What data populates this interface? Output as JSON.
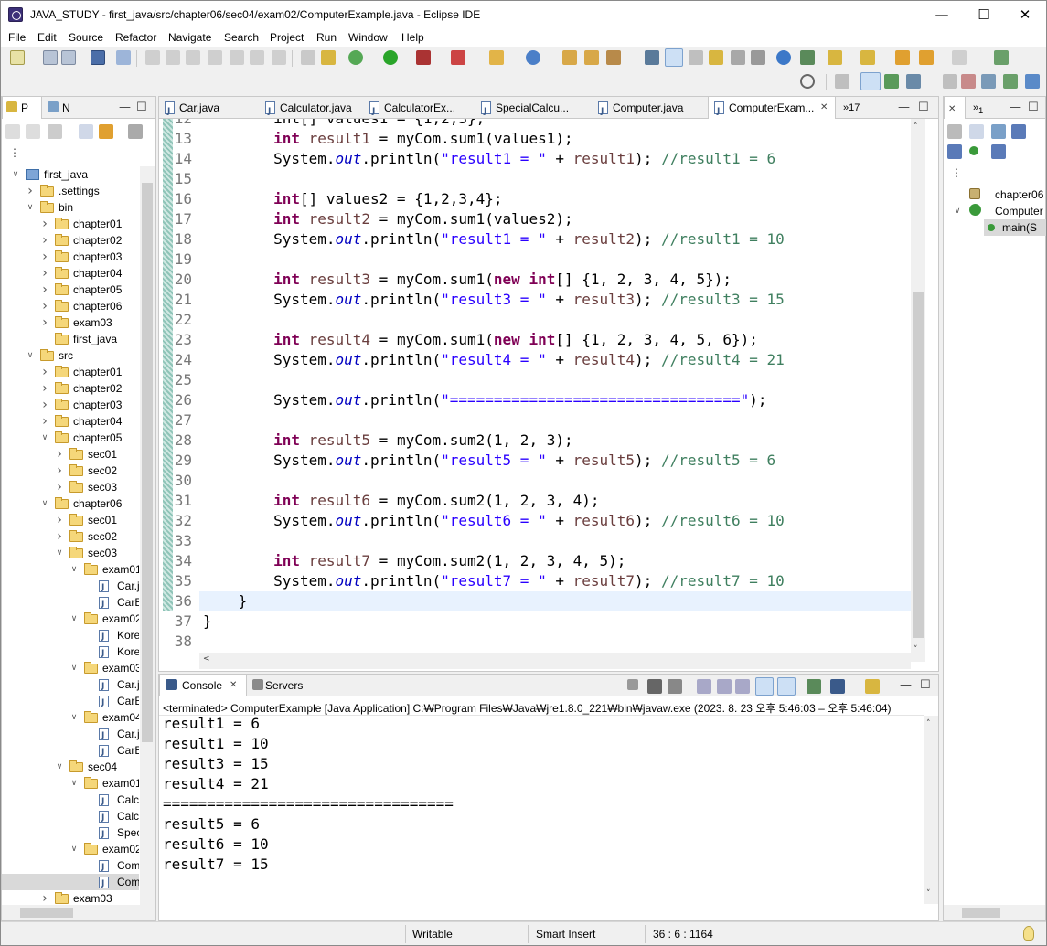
{
  "window": {
    "title": "JAVA_STUDY - first_java/src/chapter06/sec04/exam02/ComputerExample.java - Eclipse IDE",
    "minimize": "—",
    "maximize": "☐",
    "close": "✕"
  },
  "menu": [
    "File",
    "Edit",
    "Source",
    "Refactor",
    "Navigate",
    "Search",
    "Project",
    "Run",
    "Window",
    "Help"
  ],
  "left_panel": {
    "tabs": [
      "P",
      "N"
    ],
    "tree": [
      {
        "label": "first_java",
        "depth": 0,
        "open": true,
        "kind": "project"
      },
      {
        "label": ".settings",
        "depth": 1,
        "open": false,
        "kind": "folder"
      },
      {
        "label": "bin",
        "depth": 1,
        "open": true,
        "kind": "folder"
      },
      {
        "label": "chapter01",
        "depth": 2,
        "open": false,
        "kind": "folder"
      },
      {
        "label": "chapter02",
        "depth": 2,
        "open": false,
        "kind": "folder"
      },
      {
        "label": "chapter03",
        "depth": 2,
        "open": false,
        "kind": "folder"
      },
      {
        "label": "chapter04",
        "depth": 2,
        "open": false,
        "kind": "folder"
      },
      {
        "label": "chapter05",
        "depth": 2,
        "open": false,
        "kind": "folder"
      },
      {
        "label": "chapter06",
        "depth": 2,
        "open": false,
        "kind": "folder"
      },
      {
        "label": "exam03",
        "depth": 2,
        "open": false,
        "kind": "folder"
      },
      {
        "label": "first_java",
        "depth": 2,
        "open": null,
        "kind": "folder"
      },
      {
        "label": "src",
        "depth": 1,
        "open": true,
        "kind": "folder"
      },
      {
        "label": "chapter01",
        "depth": 2,
        "open": false,
        "kind": "folder"
      },
      {
        "label": "chapter02",
        "depth": 2,
        "open": false,
        "kind": "folder"
      },
      {
        "label": "chapter03",
        "depth": 2,
        "open": false,
        "kind": "folder"
      },
      {
        "label": "chapter04",
        "depth": 2,
        "open": false,
        "kind": "folder"
      },
      {
        "label": "chapter05",
        "depth": 2,
        "open": true,
        "kind": "folder"
      },
      {
        "label": "sec01",
        "depth": 3,
        "open": false,
        "kind": "folder"
      },
      {
        "label": "sec02",
        "depth": 3,
        "open": false,
        "kind": "folder"
      },
      {
        "label": "sec03",
        "depth": 3,
        "open": false,
        "kind": "folder"
      },
      {
        "label": "chapter06",
        "depth": 2,
        "open": true,
        "kind": "folder"
      },
      {
        "label": "sec01",
        "depth": 3,
        "open": false,
        "kind": "folder"
      },
      {
        "label": "sec02",
        "depth": 3,
        "open": false,
        "kind": "folder"
      },
      {
        "label": "sec03",
        "depth": 3,
        "open": true,
        "kind": "folder"
      },
      {
        "label": "exam01",
        "depth": 4,
        "open": true,
        "kind": "folder"
      },
      {
        "label": "Car.j",
        "depth": 5,
        "open": null,
        "kind": "java"
      },
      {
        "label": "CarE",
        "depth": 5,
        "open": null,
        "kind": "java"
      },
      {
        "label": "exam02",
        "depth": 4,
        "open": true,
        "kind": "folder"
      },
      {
        "label": "Kore",
        "depth": 5,
        "open": null,
        "kind": "java"
      },
      {
        "label": "Kore",
        "depth": 5,
        "open": null,
        "kind": "java"
      },
      {
        "label": "exam03",
        "depth": 4,
        "open": true,
        "kind": "folder"
      },
      {
        "label": "Car.j",
        "depth": 5,
        "open": null,
        "kind": "java"
      },
      {
        "label": "CarE",
        "depth": 5,
        "open": null,
        "kind": "java"
      },
      {
        "label": "exam04",
        "depth": 4,
        "open": true,
        "kind": "folder"
      },
      {
        "label": "Car.j",
        "depth": 5,
        "open": null,
        "kind": "java"
      },
      {
        "label": "CarE",
        "depth": 5,
        "open": null,
        "kind": "java"
      },
      {
        "label": "sec04",
        "depth": 3,
        "open": true,
        "kind": "folder"
      },
      {
        "label": "exam01",
        "depth": 4,
        "open": true,
        "kind": "folder"
      },
      {
        "label": "Calcu",
        "depth": 5,
        "open": null,
        "kind": "java"
      },
      {
        "label": "Calcu",
        "depth": 5,
        "open": null,
        "kind": "java"
      },
      {
        "label": "Spec",
        "depth": 5,
        "open": null,
        "kind": "java"
      },
      {
        "label": "exam02",
        "depth": 4,
        "open": true,
        "kind": "folder"
      },
      {
        "label": "Com",
        "depth": 5,
        "open": null,
        "kind": "java"
      },
      {
        "label": "Com",
        "depth": 5,
        "open": null,
        "kind": "java",
        "selected": true
      },
      {
        "label": "exam03",
        "depth": 2,
        "open": false,
        "kind": "folder"
      }
    ]
  },
  "editor": {
    "tabs": [
      {
        "label": "Car.java",
        "active": false
      },
      {
        "label": "Calculator.java",
        "active": false
      },
      {
        "label": "CalculatorEx...",
        "active": false
      },
      {
        "label": "SpecialCalcu...",
        "active": false
      },
      {
        "label": "Computer.java",
        "active": false
      },
      {
        "label": "ComputerExam...",
        "active": true
      }
    ],
    "overflow": "»17",
    "partial_line": "        int[] values1 = {1,2,3};",
    "lines": [
      {
        "n": "12",
        "code": []
      },
      {
        "n": "13",
        "code": [
          [
            "",
            "        "
          ],
          [
            "kw",
            "int"
          ],
          [
            "",
            " "
          ],
          [
            "var",
            "result1"
          ],
          [
            "",
            " = myCom.sum1(values1);"
          ]
        ]
      },
      {
        "n": "14",
        "code": [
          [
            "",
            "        System."
          ],
          [
            "fld",
            "out"
          ],
          [
            "",
            ".println("
          ],
          [
            "str",
            "\"result1 = \""
          ],
          [
            "",
            " + "
          ],
          [
            "var",
            "result1"
          ],
          [
            "",
            "); "
          ],
          [
            "cm",
            "//result1 = 6"
          ]
        ]
      },
      {
        "n": "15",
        "code": []
      },
      {
        "n": "16",
        "code": [
          [
            "",
            "        "
          ],
          [
            "kw",
            "int"
          ],
          [
            "",
            "[] values2 = {1,2,3,4};"
          ]
        ]
      },
      {
        "n": "17",
        "code": [
          [
            "",
            "        "
          ],
          [
            "kw",
            "int"
          ],
          [
            "",
            " "
          ],
          [
            "var",
            "result2"
          ],
          [
            "",
            " = myCom.sum1(values2);"
          ]
        ]
      },
      {
        "n": "18",
        "code": [
          [
            "",
            "        System."
          ],
          [
            "fld",
            "out"
          ],
          [
            "",
            ".println("
          ],
          [
            "str",
            "\"result1 = \""
          ],
          [
            "",
            " + "
          ],
          [
            "var",
            "result2"
          ],
          [
            "",
            "); "
          ],
          [
            "cm",
            "//result1 = 10"
          ]
        ]
      },
      {
        "n": "19",
        "code": []
      },
      {
        "n": "20",
        "code": [
          [
            "",
            "        "
          ],
          [
            "kw",
            "int"
          ],
          [
            "",
            " "
          ],
          [
            "var",
            "result3"
          ],
          [
            "",
            " = myCom.sum1("
          ],
          [
            "kw",
            "new"
          ],
          [
            "",
            " "
          ],
          [
            "kw",
            "int"
          ],
          [
            "",
            "[] {1, 2, 3, 4, 5});"
          ]
        ]
      },
      {
        "n": "21",
        "code": [
          [
            "",
            "        System."
          ],
          [
            "fld",
            "out"
          ],
          [
            "",
            ".println("
          ],
          [
            "str",
            "\"result3 = \""
          ],
          [
            "",
            " + "
          ],
          [
            "var",
            "result3"
          ],
          [
            "",
            "); "
          ],
          [
            "cm",
            "//result3 = 15"
          ]
        ]
      },
      {
        "n": "22",
        "code": []
      },
      {
        "n": "23",
        "code": [
          [
            "",
            "        "
          ],
          [
            "kw",
            "int"
          ],
          [
            "",
            " "
          ],
          [
            "var",
            "result4"
          ],
          [
            "",
            " = myCom.sum1("
          ],
          [
            "kw",
            "new"
          ],
          [
            "",
            " "
          ],
          [
            "kw",
            "int"
          ],
          [
            "",
            "[] {1, 2, 3, 4, 5, 6});"
          ]
        ]
      },
      {
        "n": "24",
        "code": [
          [
            "",
            "        System."
          ],
          [
            "fld",
            "out"
          ],
          [
            "",
            ".println("
          ],
          [
            "str",
            "\"result4 = \""
          ],
          [
            "",
            " + "
          ],
          [
            "var",
            "result4"
          ],
          [
            "",
            "); "
          ],
          [
            "cm",
            "//result4 = 21"
          ]
        ]
      },
      {
        "n": "25",
        "code": []
      },
      {
        "n": "26",
        "code": [
          [
            "",
            "        System."
          ],
          [
            "fld",
            "out"
          ],
          [
            "",
            ".println("
          ],
          [
            "str",
            "\"=================================\""
          ],
          [
            "",
            ");"
          ]
        ]
      },
      {
        "n": "27",
        "code": []
      },
      {
        "n": "28",
        "code": [
          [
            "",
            "        "
          ],
          [
            "kw",
            "int"
          ],
          [
            "",
            " "
          ],
          [
            "var",
            "result5"
          ],
          [
            "",
            " = myCom.sum2(1, 2, 3);"
          ]
        ]
      },
      {
        "n": "29",
        "code": [
          [
            "",
            "        System."
          ],
          [
            "fld",
            "out"
          ],
          [
            "",
            ".println("
          ],
          [
            "str",
            "\"result5 = \""
          ],
          [
            "",
            " + "
          ],
          [
            "var",
            "result5"
          ],
          [
            "",
            "); "
          ],
          [
            "cm",
            "//result5 = 6"
          ]
        ]
      },
      {
        "n": "30",
        "code": []
      },
      {
        "n": "31",
        "code": [
          [
            "",
            "        "
          ],
          [
            "kw",
            "int"
          ],
          [
            "",
            " "
          ],
          [
            "var",
            "result6"
          ],
          [
            "",
            " = myCom.sum2(1, 2, 3, 4);"
          ]
        ]
      },
      {
        "n": "32",
        "code": [
          [
            "",
            "        System."
          ],
          [
            "fld",
            "out"
          ],
          [
            "",
            ".println("
          ],
          [
            "str",
            "\"result6 = \""
          ],
          [
            "",
            " + "
          ],
          [
            "var",
            "result6"
          ],
          [
            "",
            "); "
          ],
          [
            "cm",
            "//result6 = 10"
          ]
        ]
      },
      {
        "n": "33",
        "code": []
      },
      {
        "n": "34",
        "code": [
          [
            "",
            "        "
          ],
          [
            "kw",
            "int"
          ],
          [
            "",
            " "
          ],
          [
            "var",
            "result7"
          ],
          [
            "",
            " = myCom.sum2(1, 2, 3, 4, 5);"
          ]
        ]
      },
      {
        "n": "35",
        "code": [
          [
            "",
            "        System."
          ],
          [
            "fld",
            "out"
          ],
          [
            "",
            ".println("
          ],
          [
            "str",
            "\"result7 = \""
          ],
          [
            "",
            " + "
          ],
          [
            "var",
            "result7"
          ],
          [
            "",
            "); "
          ],
          [
            "cm",
            "//result7 = 10"
          ]
        ]
      },
      {
        "n": "36",
        "code": [
          [
            "",
            "    }"
          ]
        ]
      },
      {
        "n": "37",
        "code": [
          [
            "",
            "}"
          ]
        ]
      },
      {
        "n": "38",
        "code": []
      }
    ]
  },
  "console": {
    "tabs": [
      {
        "label": "Console"
      },
      {
        "label": "Servers"
      }
    ],
    "header": "<terminated> ComputerExample [Java Application] C:₩Program Files₩Java₩jre1.8.0_221₩bin₩javaw.exe  (2023. 8. 23 오후 5:46:03 – 오후 5:46:04)",
    "output": [
      "result1 = 6",
      "result1 = 10",
      "result3 = 15",
      "result4 = 21",
      "=================================",
      "result5 = 6",
      "result6 = 10",
      "result7 = 15"
    ]
  },
  "outline": {
    "items": [
      {
        "label": "chapter06",
        "depth": 0
      },
      {
        "label": "Computer",
        "depth": 0
      },
      {
        "label": "main(S",
        "depth": 1
      }
    ]
  },
  "status": {
    "writable": "Writable",
    "insert": "Smart Insert",
    "position": "36 : 6 : 1164"
  }
}
